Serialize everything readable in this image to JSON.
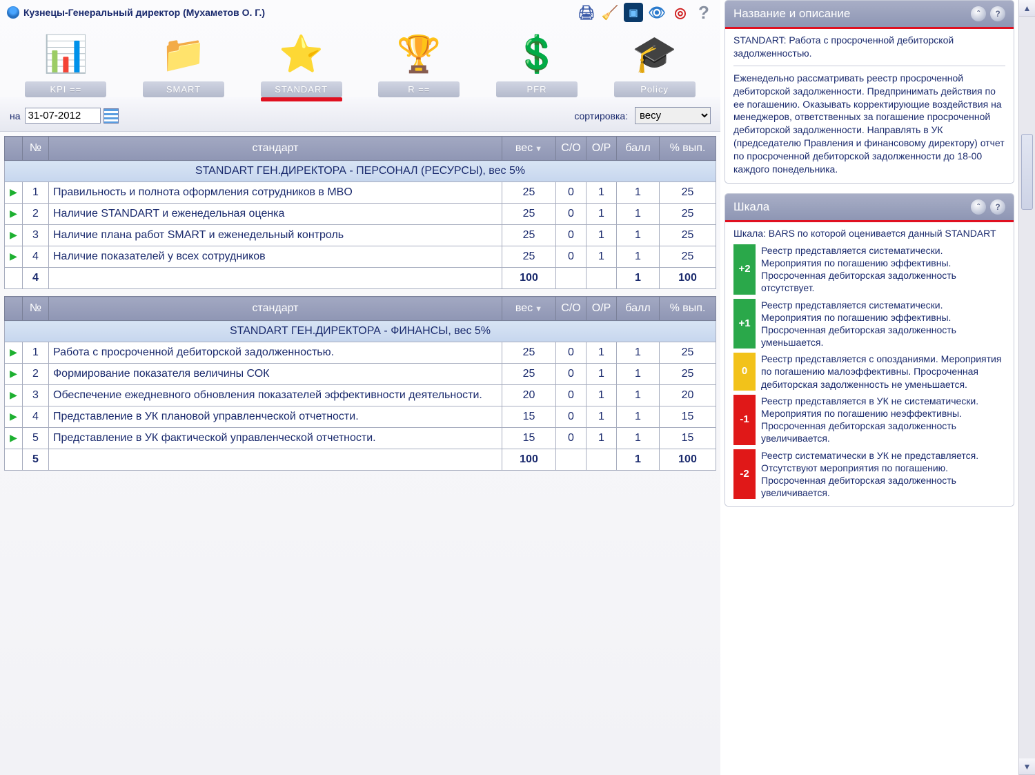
{
  "header": {
    "title": "Кузнецы-Генеральный директор  (Мухаметов О. Г.)"
  },
  "nav": {
    "items": [
      {
        "label": "KPI  =="
      },
      {
        "label": "SMART"
      },
      {
        "label": "STANDART"
      },
      {
        "label": "R  =="
      },
      {
        "label": "PFR"
      },
      {
        "label": "Policy"
      }
    ],
    "active_index": 2
  },
  "filter": {
    "date_label": "на",
    "date_value": "31-07-2012",
    "sort_label": "сортировка:",
    "sort_value": "весу"
  },
  "columns": {
    "num": "№",
    "standard": "стандарт",
    "weight": "вес",
    "so": "С/О",
    "op": "О/Р",
    "ball": "балл",
    "pct": "% вып."
  },
  "groups": [
    {
      "title": "STANDART ГЕН.ДИРЕКТОРА - ПЕРСОНАЛ (РЕСУРСЫ), вес 5%",
      "rows": [
        {
          "n": "1",
          "name": "Правильность и полнота оформления сотрудников в MBO",
          "w": "25",
          "so": "0",
          "op": "1",
          "ball": "1",
          "pct": "25"
        },
        {
          "n": "2",
          "name": "Наличие STANDART и еженедельная оценка",
          "w": "25",
          "so": "0",
          "op": "1",
          "ball": "1",
          "pct": "25"
        },
        {
          "n": "3",
          "name": "Наличие плана работ SMART и еженедельный контроль",
          "w": "25",
          "so": "0",
          "op": "1",
          "ball": "1",
          "pct": "25"
        },
        {
          "n": "4",
          "name": "Наличие показателей у всех сотрудников",
          "w": "25",
          "so": "0",
          "op": "1",
          "ball": "1",
          "pct": "25"
        }
      ],
      "total": {
        "count": "4",
        "w": "100",
        "ball": "1",
        "pct": "100"
      }
    },
    {
      "title": "STANDART ГЕН.ДИРЕКТОРА - ФИНАНСЫ, вес 5%",
      "rows": [
        {
          "n": "1",
          "name": "Работа с просроченной дебиторской задолженностью.",
          "w": "25",
          "so": "0",
          "op": "1",
          "ball": "1",
          "pct": "25"
        },
        {
          "n": "2",
          "name": "Формирование показателя величины СОК",
          "w": "25",
          "so": "0",
          "op": "1",
          "ball": "1",
          "pct": "25"
        },
        {
          "n": "3",
          "name": "Обеспечение ежедневного обновления показателей эффективности деятельности.",
          "w": "20",
          "so": "0",
          "op": "1",
          "ball": "1",
          "pct": "20"
        },
        {
          "n": "4",
          "name": "Представление в УК плановой управленческой отчетности.",
          "w": "15",
          "so": "0",
          "so_red": true,
          "op": "1",
          "ball": "1",
          "pct": "15"
        },
        {
          "n": "5",
          "name": "Представление в УК фактической управленческой отчетности.",
          "w": "15",
          "so": "0",
          "so_red": true,
          "op": "1",
          "ball": "1",
          "pct": "15"
        }
      ],
      "total": {
        "count": "5",
        "w": "100",
        "ball": "1",
        "pct": "100"
      }
    }
  ],
  "panel_desc": {
    "title": "Название и описание",
    "heading": "STANDART: Работа с просроченной дебиторской задолженностью.",
    "body": "Еженедельно рассматривать реестр просроченной дебиторской задолженности. Предпринимать действия по ее погашению. Оказывать корректирующие воздействия на менеджеров, ответственных за погашение просроченной дебиторской задолженности. Направлять в УК (председателю Правления и финансовому директору) отчет по просроченной дебиторской задолженности до 18-00 каждого понедельника."
  },
  "panel_scale": {
    "title": "Шкала",
    "intro": "Шкала: BARS по которой оценивается данный STANDART",
    "levels": [
      {
        "lvl": "+2",
        "cls": "lvl-p2",
        "text": "Реестр представляется систематически. Мероприятия по погашению эффективны. Просроченная дебиторская задолженность отсутствует."
      },
      {
        "lvl": "+1",
        "cls": "lvl-p1",
        "text": "Реестр представляется систематически. Мероприятия по погашению эффективны. Просроченная дебиторская задолженность уменьшается."
      },
      {
        "lvl": "0",
        "cls": "lvl-0",
        "text": "Реестр представляется с опозданиями. Мероприятия по погашению малоэффективны. Просроченная дебиторская задолженность не уменьшается."
      },
      {
        "lvl": "-1",
        "cls": "lvl-m1",
        "text": "Реестр представляется в УК не систематически. Мероприятия по погашению неэффективны. Просроченная дебиторская задолженность увеличивается."
      },
      {
        "lvl": "-2",
        "cls": "lvl-m2",
        "text": "Реестр систематически в УК не представляется. Отсутствуют мероприятия по погашению. Просроченная дебиторская задолженность увеличивается."
      }
    ]
  }
}
